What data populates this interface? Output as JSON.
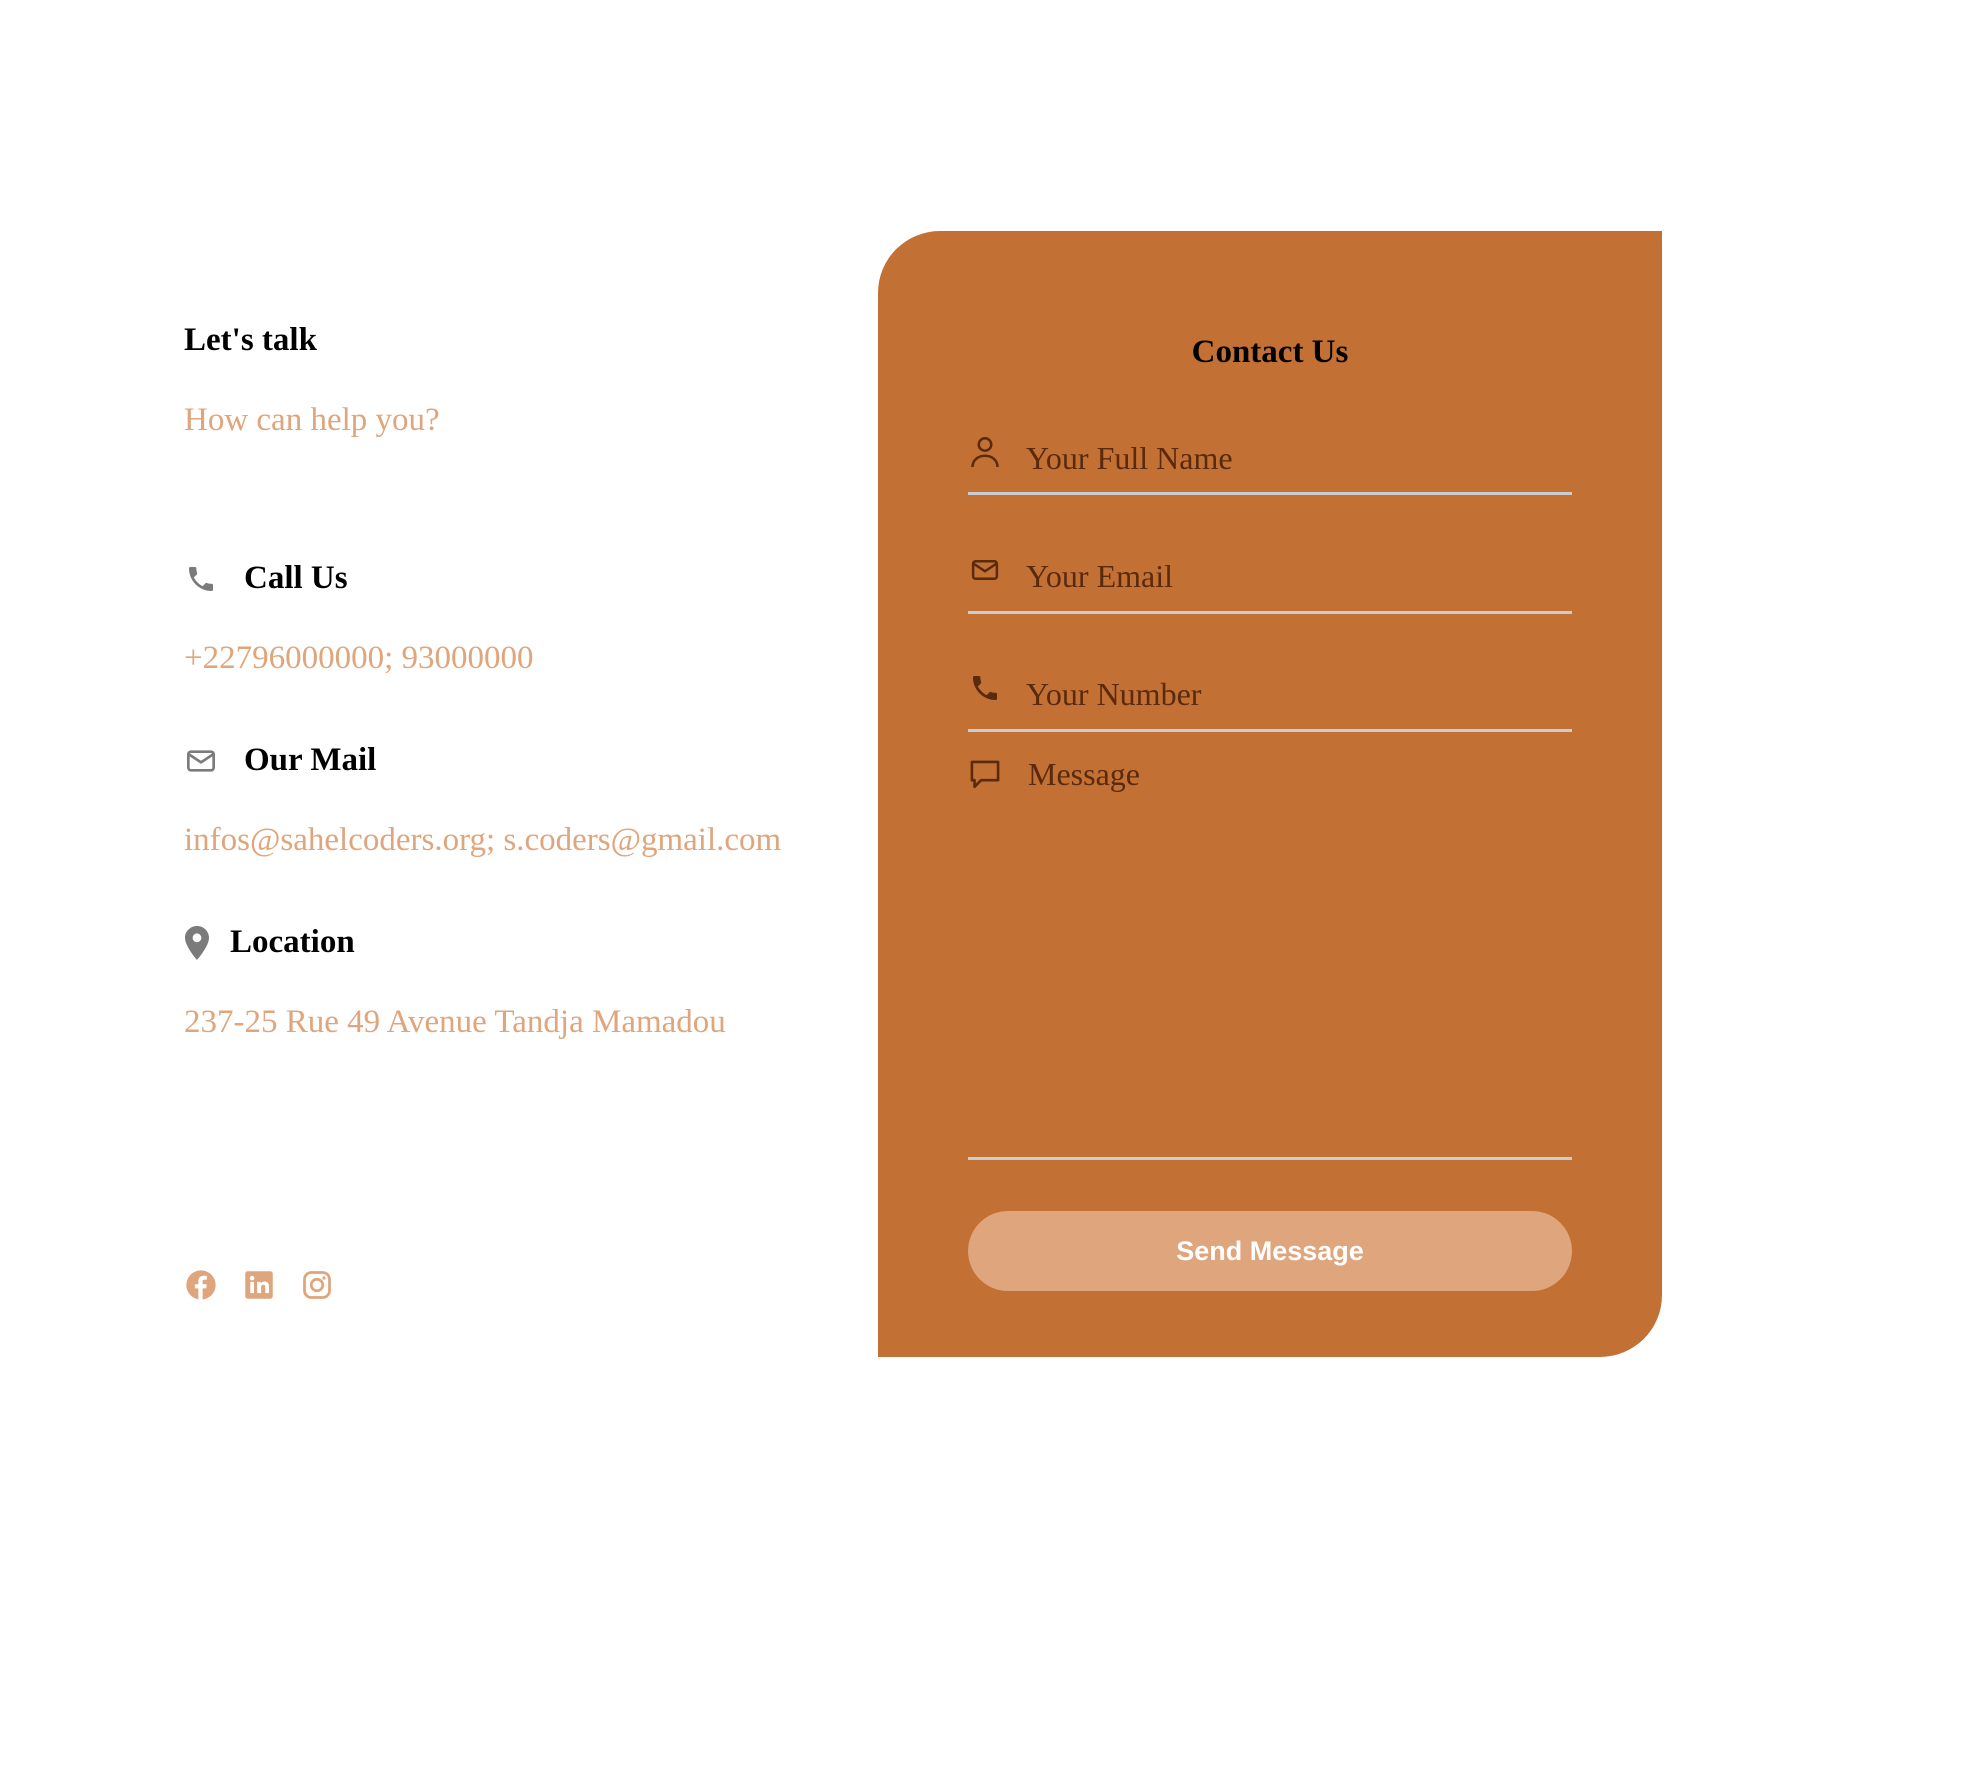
{
  "colors": {
    "accent": "#c37034",
    "muted": "#dfa57c",
    "icon_gray": "#7b7b7b",
    "input_text": "#5a2a0d",
    "underline": "#c9cdd2"
  },
  "info": {
    "title": "Let's talk",
    "subtitle": "How can help you?",
    "call": {
      "label": "Call Us",
      "value": "+22796000000; 93000000",
      "icon": "phone-icon"
    },
    "mail": {
      "label": "Our Mail",
      "value": "infos@sahelcoders.org; s.coders@gmail.com",
      "icon": "envelope-icon"
    },
    "location": {
      "label": "Location",
      "value": "237-25 Rue 49 Avenue Tandja Mamadou",
      "icon": "map-pin-icon"
    },
    "socials": [
      "facebook-icon",
      "linkedin-icon",
      "instagram-icon"
    ]
  },
  "form": {
    "title": "Contact Us",
    "fullname_placeholder": "Your Full Name",
    "email_placeholder": "Your Email",
    "number_placeholder": "Your Number",
    "message_placeholder": "Message",
    "submit_label": "Send Message"
  }
}
